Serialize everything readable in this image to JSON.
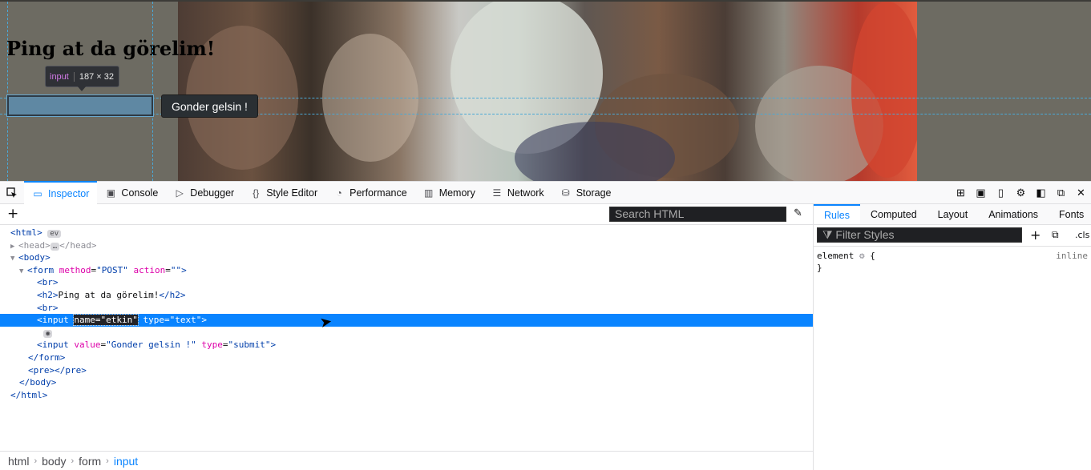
{
  "page": {
    "heading": "Ping at da görelim!",
    "submit_value": "Gonder gelsin !",
    "tooltip_tag": "input",
    "tooltip_dims": "187 × 32"
  },
  "toolbar": {
    "tabs": [
      {
        "label": "Inspector",
        "icon": "inspector-icon"
      },
      {
        "label": "Console",
        "icon": "console-icon"
      },
      {
        "label": "Debugger",
        "icon": "debugger-icon"
      },
      {
        "label": "Style Editor",
        "icon": "style-editor-icon"
      },
      {
        "label": "Performance",
        "icon": "performance-icon"
      },
      {
        "label": "Memory",
        "icon": "memory-icon"
      },
      {
        "label": "Network",
        "icon": "network-icon"
      },
      {
        "label": "Storage",
        "icon": "storage-icon"
      }
    ],
    "selected_tab": "Inspector"
  },
  "markup": {
    "search_placeholder": "Search HTML",
    "ev_badge": "ev",
    "head_ellipsis": "…",
    "tree": {
      "html_open": "<html>",
      "head": "<head>",
      "head_close": "</head>",
      "body_open": "<body>",
      "form_tag": "<form",
      "form_attr1": "method",
      "form_val1": "\"POST\"",
      "form_attr2": "action",
      "form_val2": "\"\"",
      "br": "<br>",
      "h2_open": "<h2>",
      "h2_text": "Ping at da görelim!",
      "h2_close": "</h2>",
      "input_tag": "<input",
      "input_attr1": "name",
      "input_val1": "\"etkin\"",
      "input_attr2": "type",
      "input_val2": "\"text\"",
      "input2_attr1": "value",
      "input2_val1": "\"Gonder gelsin !\"",
      "input2_attr2": "type",
      "input2_val2": "\"submit\"",
      "form_close": "</form>",
      "pre": "<pre>",
      "pre_close": "</pre>",
      "body_close": "</body>",
      "html_close": "</html>"
    },
    "breadcrumbs": [
      "html",
      "body",
      "form",
      "input"
    ]
  },
  "sidebar": {
    "tabs": [
      "Rules",
      "Computed",
      "Layout",
      "Animations",
      "Fonts"
    ],
    "selected_tab": "Rules",
    "filter_placeholder": "Filter Styles",
    "cls_label": ".cls",
    "rule_selector": "element",
    "rule_open": "{",
    "rule_close": "}",
    "rule_source": "inline"
  },
  "colors": {
    "accent": "#0a84ff",
    "selected_row": "#0a84ff",
    "tag": "#003eaa",
    "attr_name": "#dd00a9"
  }
}
